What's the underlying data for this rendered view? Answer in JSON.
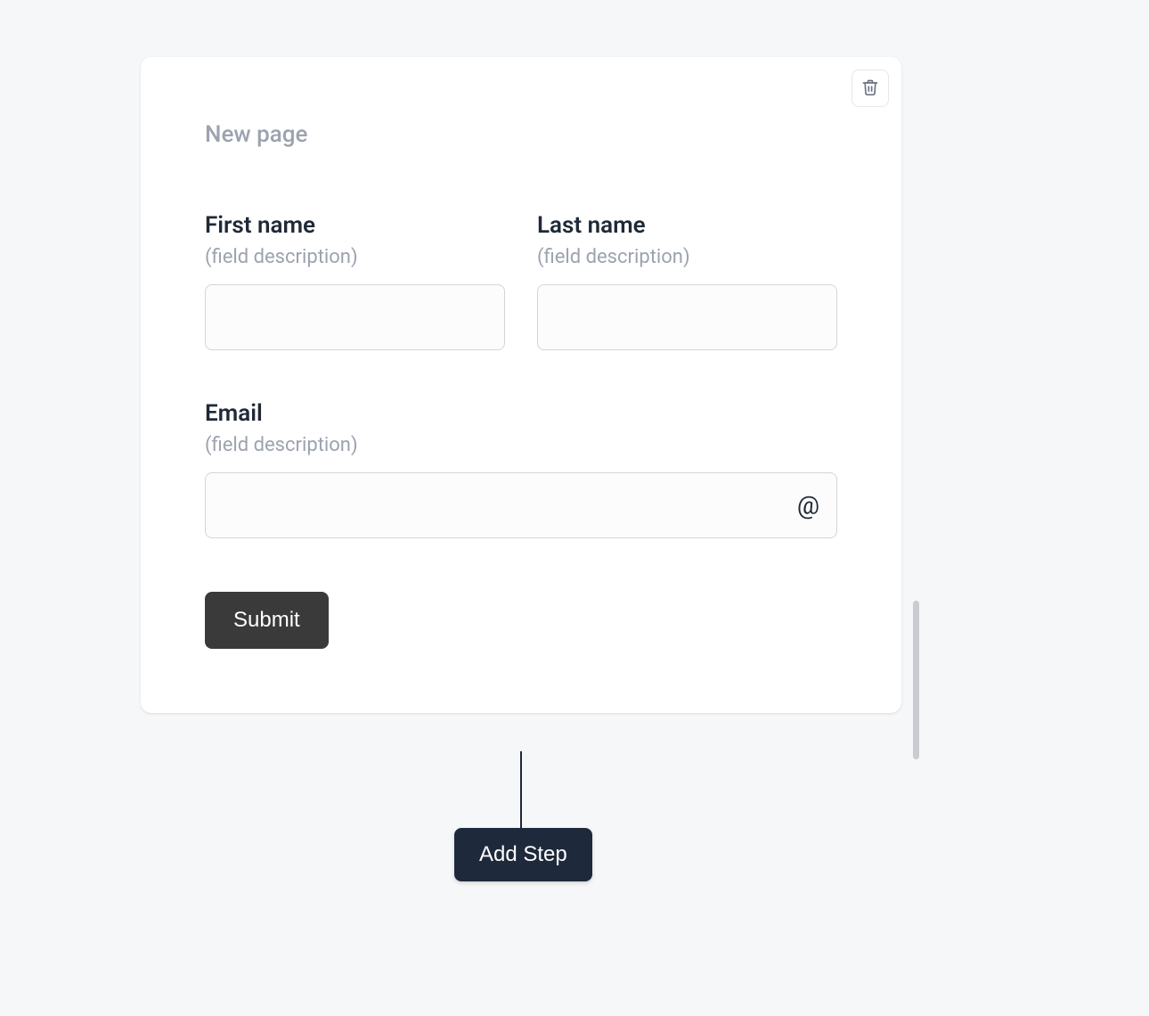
{
  "page": {
    "title_placeholder": "New page"
  },
  "fields": {
    "first_name": {
      "label": "First name",
      "description": "(field description)",
      "value": ""
    },
    "last_name": {
      "label": "Last name",
      "description": "(field description)",
      "value": ""
    },
    "email": {
      "label": "Email",
      "description": "(field description)",
      "value": "",
      "icon": "@"
    }
  },
  "buttons": {
    "submit": "Submit",
    "add_step": "Add Step"
  }
}
